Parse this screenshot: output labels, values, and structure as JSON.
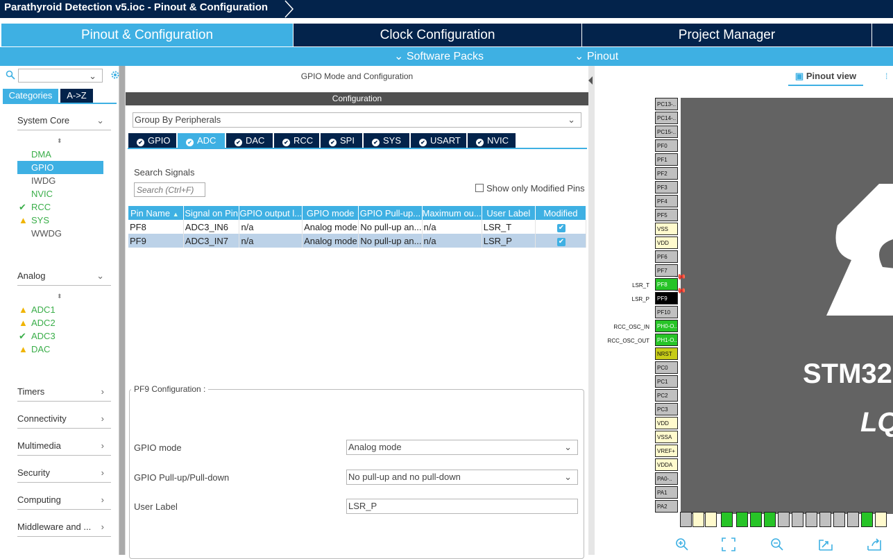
{
  "window": {
    "title": "Parathyroid Detection v5.ioc - Pinout & Configuration"
  },
  "main_tabs": [
    {
      "label": "Pinout & Configuration"
    },
    {
      "label": "Clock Configuration"
    },
    {
      "label": "Project Manager"
    }
  ],
  "sub_tabs": [
    {
      "label": "Software Packs"
    },
    {
      "label": "Pinout"
    }
  ],
  "left": {
    "search": {
      "value": "",
      "placeholder": ""
    },
    "view_tabs": [
      "Categories",
      "A->Z"
    ],
    "system_core": {
      "title": "System Core",
      "items": [
        {
          "label": "DMA",
          "status": "none"
        },
        {
          "label": "GPIO",
          "status": "selected"
        },
        {
          "label": "IWDG",
          "status": "none"
        },
        {
          "label": "NVIC",
          "status": "none"
        },
        {
          "label": "RCC",
          "status": "ok"
        },
        {
          "label": "SYS",
          "status": "warning"
        },
        {
          "label": "WWDG",
          "status": "none"
        }
      ]
    },
    "analog": {
      "title": "Analog",
      "items": [
        {
          "label": "ADC1",
          "status": "warning"
        },
        {
          "label": "ADC2",
          "status": "warning"
        },
        {
          "label": "ADC3",
          "status": "ok"
        },
        {
          "label": "DAC",
          "status": "warning"
        }
      ]
    },
    "categories": [
      "Timers",
      "Connectivity",
      "Multimedia",
      "Security",
      "Computing",
      "Middleware and ..."
    ]
  },
  "middle": {
    "header": "GPIO Mode and Configuration",
    "config_bar": "Configuration",
    "group_by": "Group By Peripherals",
    "peripheral_tabs": [
      "GPIO",
      "ADC",
      "DAC",
      "RCC",
      "SPI",
      "SYS",
      "USART",
      "NVIC"
    ],
    "active_tab": "ADC",
    "search_signals_label": "Search Signals",
    "search_placeholder": "Search (Ctrl+F)",
    "show_modified_label": "Show only Modified Pins",
    "table": {
      "columns": [
        "Pin Name",
        "Signal on Pin",
        "GPIO output l...",
        "GPIO mode",
        "GPIO Pull-up...",
        "Maximum ou...",
        "User Label",
        "Modified"
      ],
      "rows": [
        {
          "pin": "PF8",
          "signal": "ADC3_IN6",
          "output": "n/a",
          "mode": "Analog mode",
          "pull": "No pull-up an...",
          "max": "n/a",
          "label": "LSR_T",
          "modified": true
        },
        {
          "pin": "PF9",
          "signal": "ADC3_IN7",
          "output": "n/a",
          "mode": "Analog mode",
          "pull": "No pull-up an...",
          "max": "n/a",
          "label": "LSR_P",
          "modified": true
        }
      ]
    },
    "pin_config": {
      "title": "PF9 Configuration :",
      "gpio_mode_label": "GPIO mode",
      "gpio_mode_value": "Analog mode",
      "pull_label": "GPIO Pull-up/Pull-down",
      "pull_value": "No pull-up and no pull-down",
      "user_label_label": "User Label",
      "user_label_value": "LSR_P"
    }
  },
  "right": {
    "pinout_view_label": "Pinout view",
    "chip_text_1": "STM32",
    "chip_text_2": "LQ",
    "left_pins": [
      "PC13-..",
      "PC14-..",
      "PC15-..",
      "PF0",
      "PF1",
      "PF2",
      "PF3",
      "PF4",
      "PF5",
      "VSS",
      "VDD",
      "PF6",
      "PF7",
      "PF8",
      "PF9",
      "PF10",
      "PH0-O..",
      "PH1-O..",
      "NRST",
      "PC0",
      "PC1",
      "PC2",
      "PC3",
      "VDD",
      "VSSA",
      "VREF+",
      "VDDA",
      "PA0-..",
      "PA1",
      "PA2"
    ],
    "pin_labels": {
      "PF8": "LSR_T",
      "PF9": "LSR_P",
      "PH0": "RCC_OSC_IN",
      "PH1": "RCC_OSC_OUT"
    }
  }
}
